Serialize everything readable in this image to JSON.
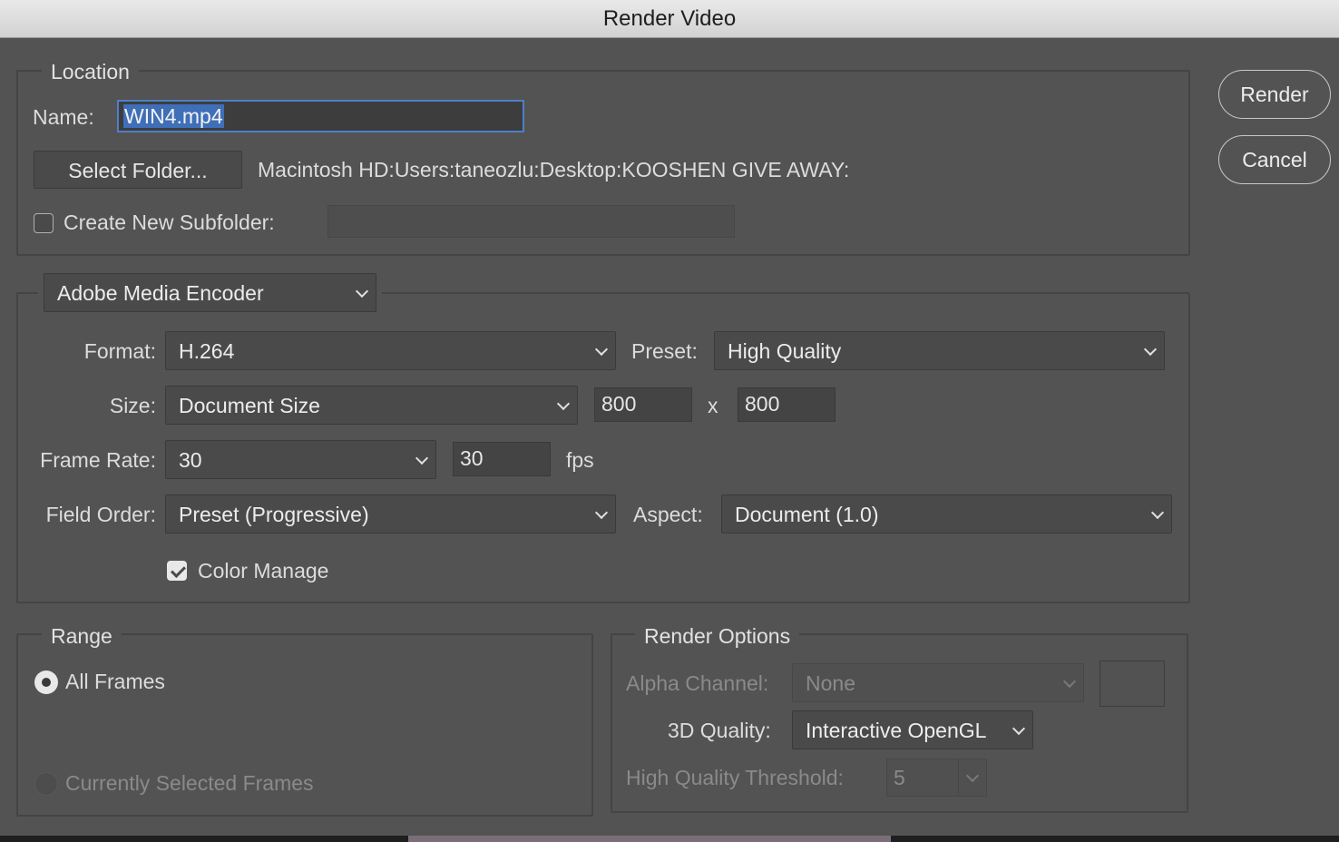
{
  "window": {
    "title": "Render Video"
  },
  "location": {
    "legend": "Location",
    "name_label": "Name:",
    "name_value": "WIN4.mp4",
    "select_folder_label": "Select Folder...",
    "folder_path": "Macintosh HD:Users:taneozlu:Desktop:KOOSHEN GIVE AWAY:",
    "create_subfolder_label": "Create New Subfolder:",
    "create_subfolder_checked": false,
    "subfolder_value": ""
  },
  "actions": {
    "render_label": "Render",
    "cancel_label": "Cancel"
  },
  "encoder": {
    "selected": "Adobe Media Encoder",
    "format_label": "Format:",
    "format_value": "H.264",
    "preset_label": "Preset:",
    "preset_value": "High Quality",
    "size_label": "Size:",
    "size_value": "Document Size",
    "width": "800",
    "times": "x",
    "height": "800",
    "frame_rate_label": "Frame Rate:",
    "frame_rate_value": "30",
    "fps_value": "30",
    "fps_unit": "fps",
    "field_order_label": "Field Order:",
    "field_order_value": "Preset (Progressive)",
    "aspect_label": "Aspect:",
    "aspect_value": "Document (1.0)",
    "color_manage_label": "Color Manage",
    "color_manage_checked": true
  },
  "range": {
    "legend": "Range",
    "all_frames_label": "All Frames",
    "all_frames_selected": true,
    "selected_frames_label": "Currently Selected Frames",
    "selected_frames_enabled": false
  },
  "render_options": {
    "legend": "Render Options",
    "alpha_label": "Alpha Channel:",
    "alpha_value": "None",
    "quality_3d_label": "3D Quality:",
    "quality_3d_value": "Interactive OpenGL",
    "threshold_label": "High Quality Threshold:",
    "threshold_value": "5"
  }
}
